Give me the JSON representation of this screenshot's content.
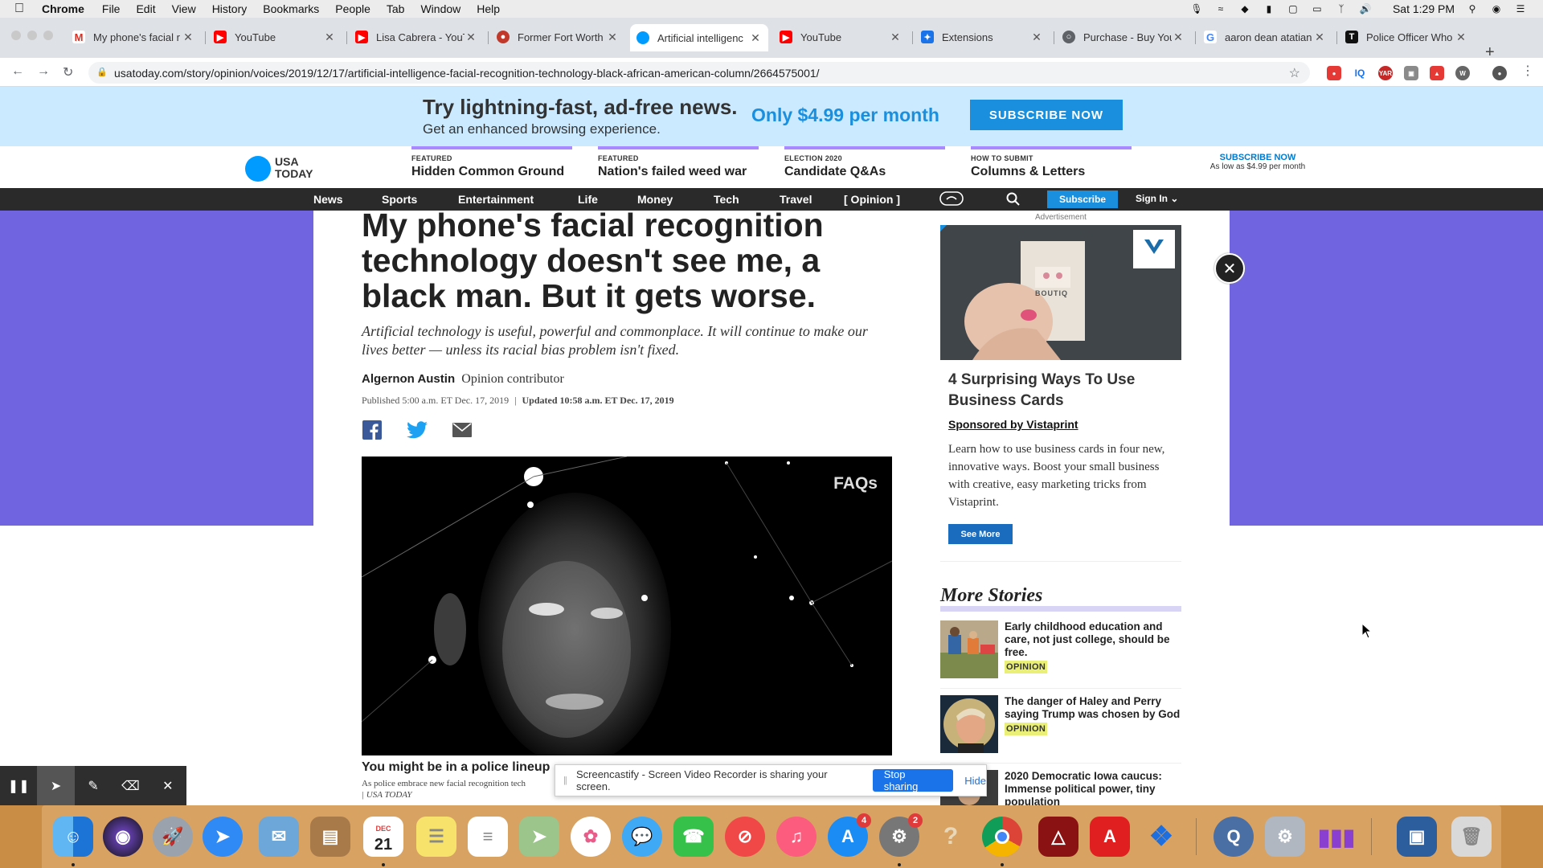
{
  "menubar": {
    "app": "Chrome",
    "items": [
      "File",
      "Edit",
      "View",
      "History",
      "Bookmarks",
      "People",
      "Tab",
      "Window",
      "Help"
    ],
    "clock": "Sat 1:29 PM"
  },
  "tabs": [
    {
      "title": "My phone's facial r",
      "icon": "gmail-icon",
      "color": "#d93025"
    },
    {
      "title": "YouTube",
      "icon": "youtube-icon",
      "color": "#ff0000"
    },
    {
      "title": "Lisa Cabrera - YouT",
      "icon": "youtube-icon",
      "color": "#ff0000"
    },
    {
      "title": "Former Fort Worth",
      "icon": "news-icon",
      "color": "#c0392b"
    },
    {
      "title": "Artificial intelligenc",
      "icon": "usatoday-icon",
      "color": "#009bff"
    },
    {
      "title": "YouTube",
      "icon": "youtube-icon",
      "color": "#ff0000"
    },
    {
      "title": "Extensions",
      "icon": "puzzle-icon",
      "color": "#1a73e8"
    },
    {
      "title": "Purchase - Buy You",
      "icon": "globe-icon",
      "color": "#5f6368"
    },
    {
      "title": "aaron dean atatian",
      "icon": "google-icon",
      "color": "#4285f4"
    },
    {
      "title": "Police Officer Who",
      "icon": "nyt-icon",
      "color": "#111111"
    }
  ],
  "omnibox": {
    "url": "usatoday.com/story/opinion/voices/2019/12/17/artificial-intelligence-facial-recognition-technology-black-african-american-column/2664575001/"
  },
  "promo": {
    "headline": "Try lightning-fast, ad-free news.",
    "sub": "Get an enhanced browsing experience.",
    "price": "Only $4.99 per month",
    "button": "SUBSCRIBE NOW"
  },
  "masthead": {
    "logo": "USA TODAY",
    "features": [
      {
        "kicker": "FEATURED",
        "title": "Hidden Common Ground"
      },
      {
        "kicker": "FEATURED",
        "title": "Nation's failed weed war"
      },
      {
        "kicker": "ELECTION 2020",
        "title": "Candidate Q&As"
      },
      {
        "kicker": "HOW TO SUBMIT",
        "title": "Columns & Letters"
      }
    ],
    "subscribe_title": "SUBSCRIBE NOW",
    "subscribe_sub": "As low as $4.99 per month"
  },
  "nav": {
    "items": [
      "News",
      "Sports",
      "Entertainment",
      "Life",
      "Money",
      "Tech",
      "Travel",
      "[ Opinion ]"
    ],
    "subscribe": "Subscribe",
    "signin": "Sign In"
  },
  "article": {
    "headline": "My phone's facial recognition technology doesn't see me, a black man. But it gets worse.",
    "dek": "Artificial technology is useful, powerful and commonplace. It will continue to make our lives better — unless its racial bias problem isn't fixed.",
    "author": "Algernon Austin",
    "author_role": "Opinion contributor",
    "published": "Published 5:00 a.m. ET Dec. 17, 2019",
    "updated": "Updated 10:58 a.m. ET Dec. 17, 2019",
    "video_badge": "FAQs",
    "caption_title": "You might be in a police lineup",
    "caption_text": "As police embrace new facial recognition tech",
    "caption_source": "| USA TODAY"
  },
  "ad": {
    "label": "Advertisement",
    "card_text": "BOUTIQ",
    "title": "4 Surprising Ways To Use Business Cards",
    "sponsor": "Sponsored by Vistaprint",
    "body": "Learn how to use business cards in four new, innovative ways. Boost your small business with creative, easy marketing tricks from Vistaprint.",
    "button": "See More"
  },
  "more_stories": {
    "title": "More Stories",
    "items": [
      {
        "title": "Early childhood education and care, not just college, should be free.",
        "label": "OPINION"
      },
      {
        "title": "The danger of Haley and Perry saying Trump was chosen by God",
        "label": "OPINION"
      },
      {
        "title": "2020 Democratic Iowa caucus: Immense political power, tiny population",
        "label": ""
      }
    ]
  },
  "screencastify": {
    "message": "Screencastify - Screen Video Recorder is sharing your screen.",
    "stop": "Stop sharing",
    "hide": "Hide"
  },
  "dock": {
    "calendar_month": "DEC",
    "calendar_day": "21",
    "appstore_badge": "4",
    "settings_badge": "2"
  }
}
